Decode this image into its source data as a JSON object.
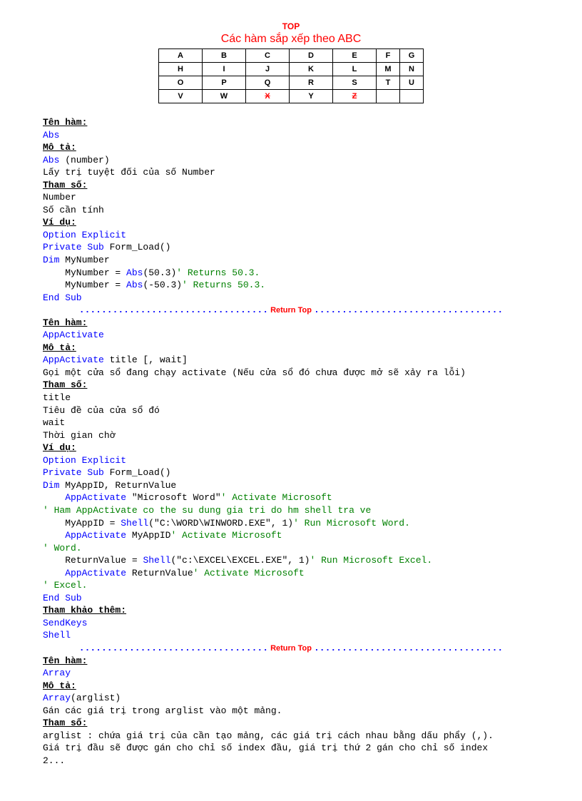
{
  "header": {
    "top": "TOP",
    "title": "Các hàm sắp xếp theo ABC"
  },
  "alpha": {
    "rows": [
      [
        "A",
        "B",
        "C",
        "D",
        "E",
        "F",
        "G"
      ],
      [
        "H",
        "I",
        "J",
        "K",
        "L",
        "M",
        "N"
      ],
      [
        "O",
        "P",
        "Q",
        "R",
        "S",
        "T",
        "U"
      ],
      [
        "V",
        "W",
        "X",
        "Y",
        "Z",
        "",
        ""
      ]
    ],
    "strike": [
      "X",
      "Z"
    ]
  },
  "labels": {
    "ten_ham": "Tên hàm:",
    "mo_ta": "Mô tả:",
    "tham_so": "Tham số:",
    "vi_du": "Ví dụ:",
    "tham_khao": "Tham khảo thêm:"
  },
  "sep": {
    "dots_left": "..................................",
    "return_top": " Return Top ",
    "dots_right": ".................................."
  },
  "func1": {
    "name": "Abs",
    "desc_sig": "Abs",
    "desc_sig_rest": " (number)",
    "desc_text": "Lấy trị tuyệt đối của số Number",
    "param1": "Number",
    "param1_desc": "Số cần tính",
    "code": {
      "l1": "Option Explicit",
      "l2a": "Private Sub",
      "l2b": " Form_Load()",
      "l3a": "Dim",
      "l3b": " MyNumber",
      "l4a": "    MyNumber = ",
      "l4b": "Abs",
      "l4c": "(50.3)",
      "l4d": "' Returns 50.3.",
      "l5a": "    MyNumber = ",
      "l5b": "Abs",
      "l5c": "(-50.3)",
      "l5d": "' Returns 50.3.",
      "l6": "End Sub"
    }
  },
  "func2": {
    "name": "AppActivate",
    "desc_sig": "AppActivate",
    "desc_sig_rest": " title [, wait]",
    "desc_text": "Gọi một cửa sổ đang chạy activate (Nếu cửa sổ đó chưa được mở sẽ xảy ra lỗi)",
    "param1": "title",
    "param1_desc": "Tiêu đề của cửa sổ đó",
    "param2": "wait",
    "param2_desc": "Thời gian chờ",
    "code": {
      "l1": "Option Explicit",
      "l2a": "Private Sub",
      "l2b": " Form_Load()",
      "l3a": "Dim",
      "l3b": " MyAppID, ReturnValue",
      "l4a": "    AppActivate",
      "l4b": " \"Microsoft Word\"",
      "l4c": "' Activate Microsoft",
      "l5": "' Ham AppActivate co the su dung gia tri do hm shell tra ve",
      "l6a": "    MyAppID = ",
      "l6b": "Shell",
      "l6c": "(\"C:\\WORD\\WINWORD.EXE\", 1)",
      "l6d": "' Run Microsoft Word.",
      "l7a": "    AppActivate",
      "l7b": " MyAppID",
      "l7c": "' Activate Microsoft",
      "l8": "' Word.",
      "l9a": "    ReturnValue = ",
      "l9b": "Shell",
      "l9c": "(\"c:\\EXCEL\\EXCEL.EXE\", 1)",
      "l9d": "' Run Microsoft Excel.",
      "l10a": "    AppActivate",
      "l10b": " ReturnValue",
      "l10c": "' Activate Microsoft",
      "l11": "' Excel.",
      "l12": "End Sub"
    },
    "see1": "SendKeys",
    "see2": "Shell"
  },
  "func3": {
    "name": "Array",
    "desc_sig": "Array",
    "desc_sig_rest": "(arglist)",
    "desc_text": "Gán các giá trị trong arglist vào một mảng.",
    "param_text1": "arglist : chứa giá trị của cần tạo mảng, các giá trị cách nhau bằng dấu phẩy (,).",
    "param_text2": "Giá trị đầu sẽ được gán cho chỉ số index đầu, giá trị thứ 2 gán cho chỉ số index",
    "param_text3": "2..."
  }
}
